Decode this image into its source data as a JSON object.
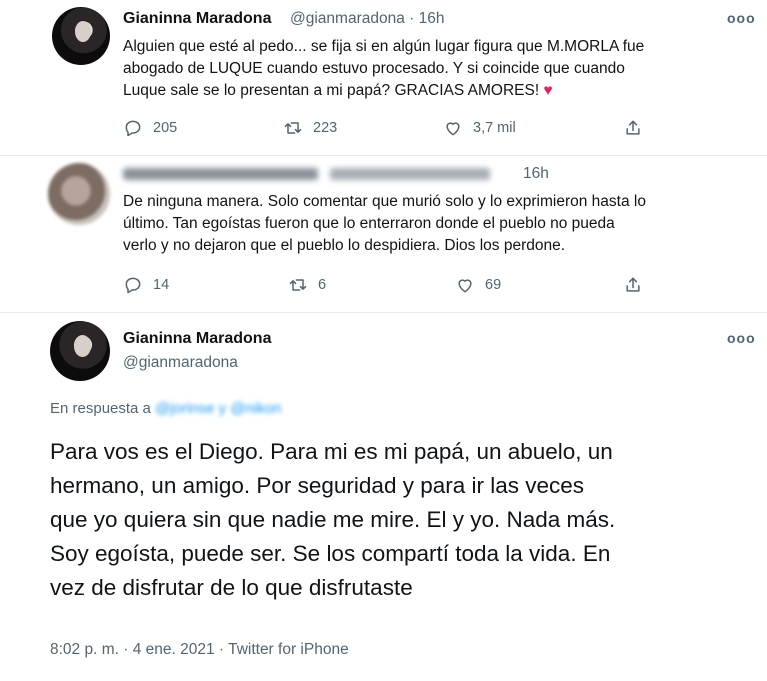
{
  "tweet1": {
    "name": "Gianinna Maradona",
    "meta": "@gianmaradona · 16h",
    "text_line1": "Alguien que esté al pedo... se fija si en algún lugar figura que M.MORLA fue",
    "text_line2": "abogado de LUQUE cuando estuvo procesado. Y si coincide que cuando",
    "text_line3": "Luque sale se lo presentan a mi papá? GRACIAS AMORES! ",
    "heart": "♥",
    "replies": "205",
    "retweets": "223",
    "likes": "3,7 mil"
  },
  "tweet2": {
    "time": "16h",
    "text_line1": "De ninguna manera. Solo comentar que murió solo y lo exprimieron hasta lo",
    "text_line2": "último. Tan egoístas fueron que lo enterraron donde el pueblo no pueda",
    "text_line3": "verlo y no dejaron que el pueblo lo despidiera. Dios los perdone.",
    "replies": "14",
    "retweets": "6",
    "likes": "69"
  },
  "tweet3": {
    "name": "Gianinna Maradona",
    "handle": "@gianmaradona",
    "reply_prefix": "En respuesta a ",
    "reply_handles": "@jorinse y @nikon",
    "line1": "Para vos es el Diego. Para mi es mi papá, un abuelo, un",
    "line2": "hermano, un amigo. Por seguridad y para ir las veces",
    "line3": "que yo quiera sin que nadie me mire. El y yo. Nada más.",
    "line4": "Soy egoísta, puede ser. Se los compartí toda la vida. En",
    "line5": "vez de disfrutar de lo que disfrutaste",
    "footer": "8:02 p. m. · 4 ene. 2021 · Twitter for iPhone"
  },
  "icons": {
    "more": "ooo",
    "reply": "reply-icon",
    "retweet": "retweet-icon",
    "like": "like-icon",
    "share": "share-icon"
  },
  "colors": {
    "text": "#0f1419",
    "secondary": "#536471",
    "link": "#1d9bf0",
    "heart": "#e0245e"
  }
}
